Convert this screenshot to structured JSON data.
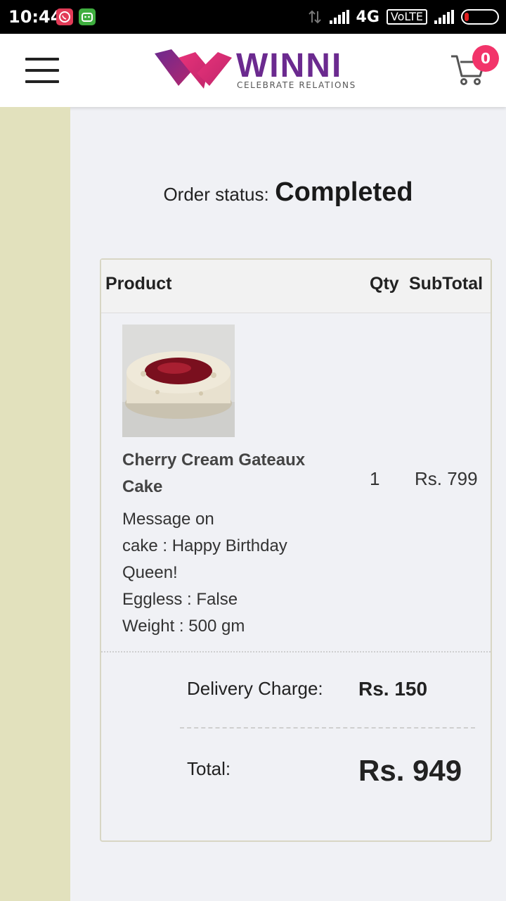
{
  "status_bar": {
    "time": "10:44",
    "network": "4G",
    "volte": "VoLTE"
  },
  "header": {
    "brand": "WINNI",
    "tagline": "CELEBRATE RELATIONS",
    "cart_count": "0"
  },
  "order": {
    "status_label": "Order status:",
    "status_value": "Completed"
  },
  "table": {
    "headers": {
      "product": "Product",
      "qty": "Qty",
      "subtotal": "SubTotal"
    },
    "items": [
      {
        "name": "Cherry Cream Gateaux Cake",
        "meta": [
          "Message on",
          "cake :  Happy Birthday",
          "Queen!",
          "Eggless :  False",
          "Weight :  500 gm"
        ],
        "qty": "1",
        "subtotal": "Rs. 799"
      }
    ],
    "delivery_label": "Delivery Charge:",
    "delivery_value": "Rs. 150",
    "total_label": "Total:",
    "total_value": "Rs. 949"
  },
  "colors": {
    "brand_purple": "#6b2a8f",
    "brand_pink": "#e8337a",
    "badge": "#f2346a",
    "side_strip": "#e2e1bd",
    "page_bg": "#f0f1f5"
  }
}
